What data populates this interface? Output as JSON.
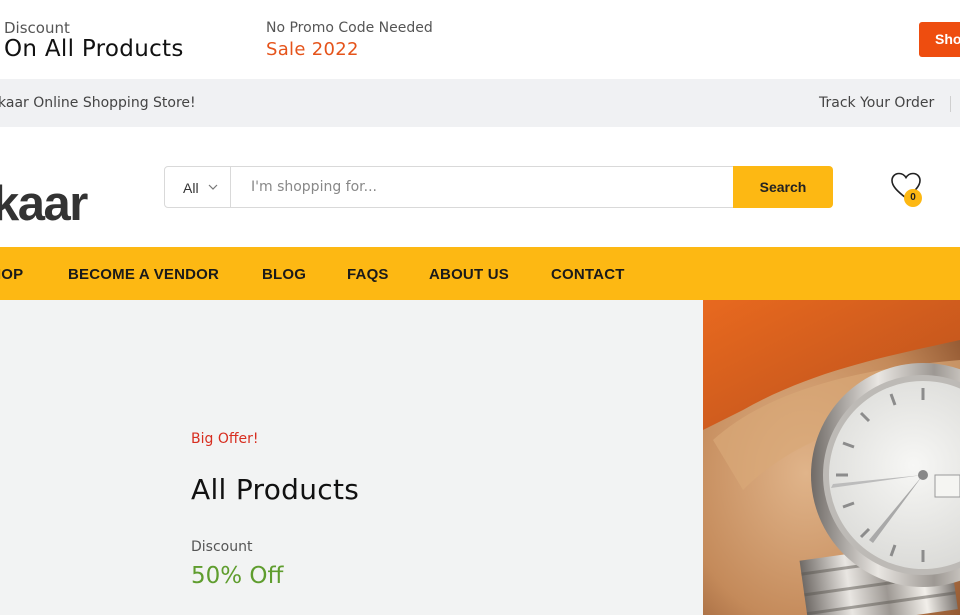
{
  "promo": {
    "discount_label": "Discount",
    "discount_title": "On All Products",
    "code_label": "No Promo Code Needed",
    "code_value": "Sale 2022",
    "shop_button": "Shop Now"
  },
  "info_strip": {
    "welcome": "kaar Online Shopping Store!",
    "track_order": "Track Your Order"
  },
  "header": {
    "logo": "kaar",
    "search": {
      "category": "All",
      "placeholder": "I'm shopping for...",
      "button": "Search"
    },
    "wishlist_count": "0"
  },
  "nav": {
    "items": [
      "SHOP",
      "BECOME A VENDOR",
      "BLOG",
      "FAQS",
      "ABOUT US",
      "CONTACT"
    ]
  },
  "hero": {
    "tag": "Big Offer!",
    "title": "All Products",
    "discount_label": "Discount",
    "discount_value": "50% Off",
    "image_icon": "wristwatch-image"
  },
  "colors": {
    "accent": "#fdb813",
    "promo_button": "#ee4d0f",
    "sale_text": "#e5531a",
    "offer_tag": "#d72d1f",
    "discount_green": "#5f9d2e"
  }
}
